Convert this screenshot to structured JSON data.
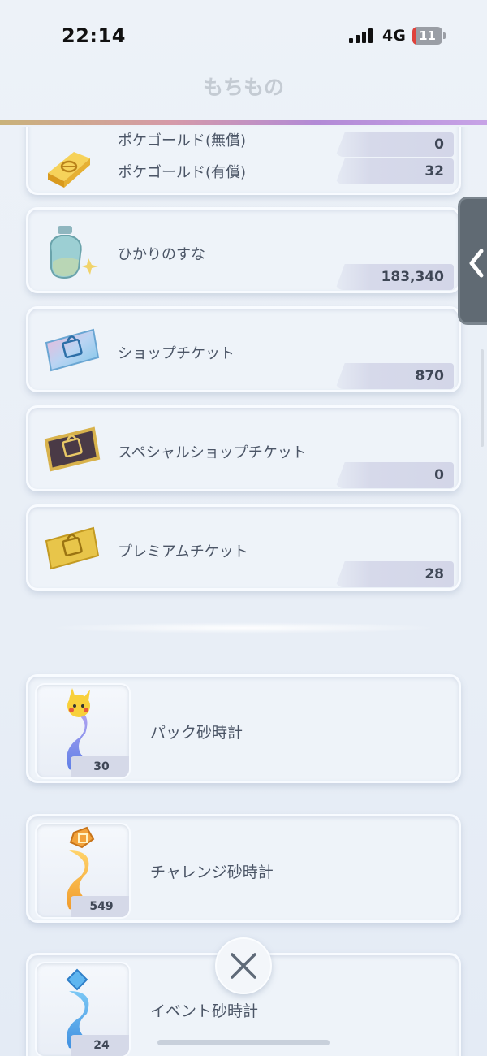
{
  "status_bar": {
    "time": "22:14",
    "network": "4G",
    "battery": "11",
    "battery_level": 0.11
  },
  "header": {
    "title": "もちもの"
  },
  "items": [
    {
      "label_free": "ポケゴールド(無償)",
      "count_free": "0",
      "label_paid": "ポケゴールド(有償)",
      "count_paid": "32",
      "icon": "gold-bar-icon"
    },
    {
      "label": "ひかりのすな",
      "count": "183,340",
      "icon": "sand-bottle-icon"
    },
    {
      "label": "ショップチケット",
      "count": "870",
      "icon": "shop-ticket-icon"
    },
    {
      "label": "スペシャルショップチケット",
      "count": "0",
      "icon": "special-shop-ticket-icon"
    },
    {
      "label": "プレミアムチケット",
      "count": "28",
      "icon": "premium-ticket-icon"
    }
  ],
  "hourglasses": [
    {
      "label": "パック砂時計",
      "count": "30",
      "icon": "pack-hourglass-icon"
    },
    {
      "label": "チャレンジ砂時計",
      "count": "549",
      "icon": "challenge-hourglass-icon"
    },
    {
      "label": "イベント砂時計",
      "count": "24",
      "icon": "event-hourglass-icon"
    }
  ],
  "side_tab": {
    "icon": "chevron-left-icon"
  },
  "close_button": {
    "icon": "close-icon"
  },
  "colors": {
    "accent_rainbow_start": "#c9b27a",
    "accent_rainbow_end": "#c7a3e6",
    "side_tab": "#606a73"
  }
}
